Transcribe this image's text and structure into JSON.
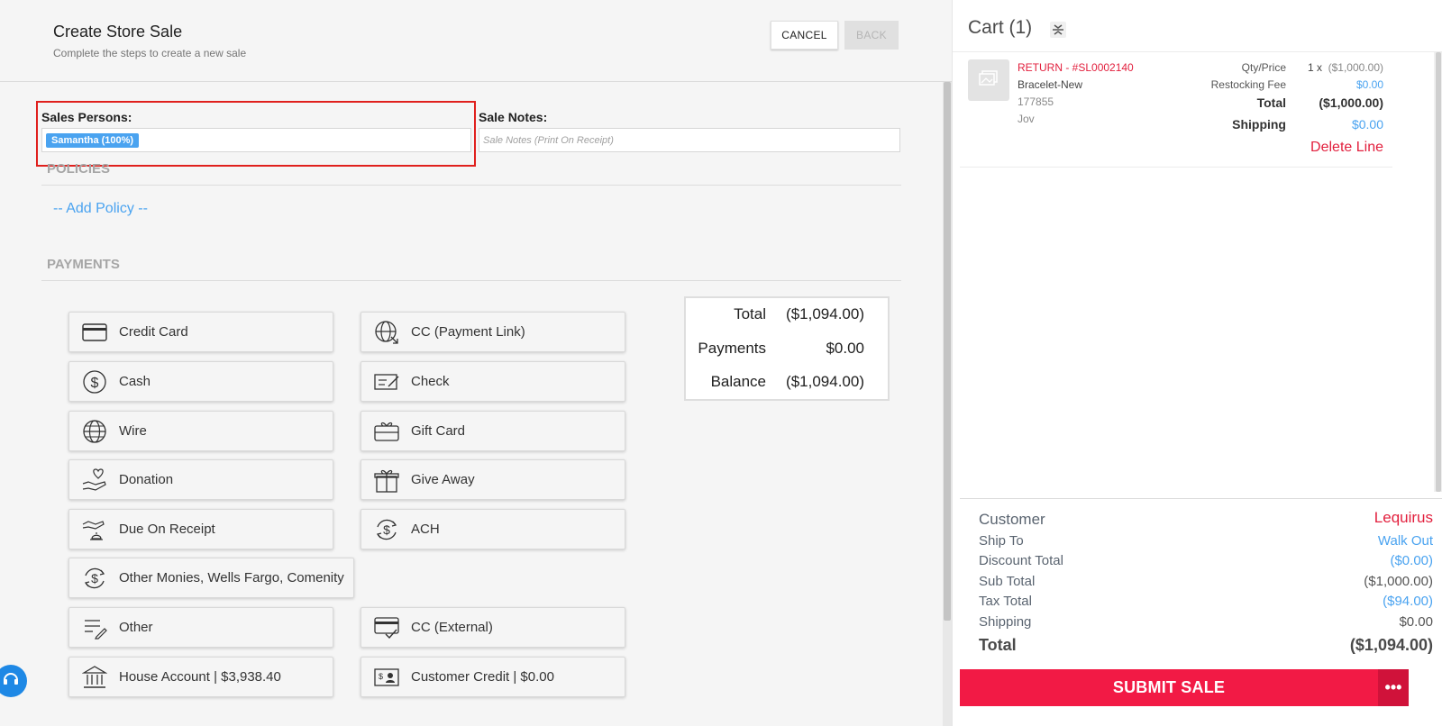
{
  "header": {
    "title": "Create Store Sale",
    "subtitle": "Complete the steps to create a new sale",
    "cancel_label": "CANCEL",
    "back_label": "BACK"
  },
  "form": {
    "sales_persons_label": "Sales Persons:",
    "sales_person_chip": "Samantha (100%)",
    "sale_notes_label": "Sale Notes:",
    "sale_notes_placeholder": "Sale Notes (Print On Receipt)",
    "sale_notes_value": ""
  },
  "policies": {
    "title": "POLICIES",
    "add_policy": "-- Add Policy --"
  },
  "payments": {
    "title": "PAYMENTS",
    "methods": [
      {
        "label": "Credit Card",
        "icon": "credit-card-icon"
      },
      {
        "label": "CC (Payment Link)",
        "icon": "globe-link-icon"
      },
      {
        "label": "Cash",
        "icon": "dollar-coin-icon"
      },
      {
        "label": "Check",
        "icon": "check-icon"
      },
      {
        "label": "Wire",
        "icon": "globe-icon"
      },
      {
        "label": "Gift Card",
        "icon": "gift-card-icon"
      },
      {
        "label": "Donation",
        "icon": "donation-hand-icon"
      },
      {
        "label": "Give Away",
        "icon": "gift-box-icon"
      },
      {
        "label": "Due On Receipt",
        "icon": "due-receipt-icon"
      },
      {
        "label": "ACH",
        "icon": "ach-icon"
      },
      {
        "label": "Other Monies, Wells Fargo, Comenity",
        "icon": "other-monies-icon"
      },
      {
        "label": "Other",
        "icon": "list-pen-icon"
      },
      {
        "label": "CC (External)",
        "icon": "card-check-icon"
      },
      {
        "label": "House Account | $3,938.40",
        "icon": "bank-icon"
      },
      {
        "label": "Customer Credit | $0.00",
        "icon": "id-card-icon"
      }
    ],
    "totals": {
      "total_label": "Total",
      "total_value": "($1,094.00)",
      "payments_label": "Payments",
      "payments_value": "$0.00",
      "balance_label": "Balance",
      "balance_value": "($1,094.00)"
    }
  },
  "cart": {
    "title": "Cart (1)",
    "item": {
      "name": "RETURN - #SL0002140",
      "product": "Bracelet-New",
      "sku": "177855",
      "vendor": "Jov",
      "qty_price_label": "Qty/Price",
      "qty_price_qty": "1 x",
      "qty_price_value": "($1,000.00)",
      "restocking_label": "Restocking Fee",
      "restocking_value": "$0.00",
      "total_label": "Total",
      "total_value": "($1,000.00)",
      "shipping_label": "Shipping",
      "shipping_value": "$0.00",
      "delete_label": "Delete Line"
    },
    "summary": {
      "customer_label": "Customer",
      "customer_value": "Lequirus",
      "ship_to_label": "Ship To",
      "ship_to_value": "Walk Out",
      "discount_label": "Discount Total",
      "discount_value": "($0.00)",
      "subtotal_label": "Sub Total",
      "subtotal_value": "($1,000.00)",
      "tax_label": "Tax Total",
      "tax_value": "($94.00)",
      "shipping_label": "Shipping",
      "shipping_value": "$0.00",
      "total_label": "Total",
      "total_value": "($1,094.00)"
    },
    "submit_label": "SUBMIT SALE",
    "more_label": "•••"
  },
  "colors": {
    "accent_blue": "#4aa3f0",
    "danger_red": "#e21f3d",
    "submit_red": "#f21a45"
  }
}
